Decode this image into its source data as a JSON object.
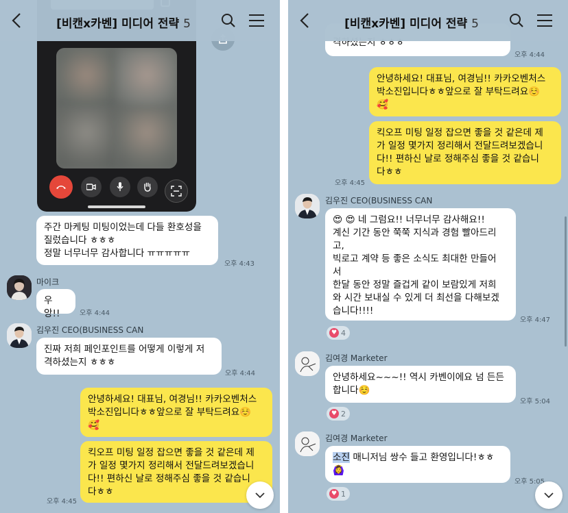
{
  "chat": {
    "title": "[비캔x카벤] 미디어 전략",
    "member_count": "5"
  },
  "colors": {
    "background": "#abc1d1",
    "incoming": "#ffffff",
    "outgoing": "#fbe64d",
    "heart": "#e94b6a"
  },
  "left": {
    "msg1": {
      "text": "주간 마케팅 미팅이었는데 다들 환호성을\n질렀습니다 ㅎㅎㅎ\n정말 너무너무 감사합니다 ㅠㅠㅠㅠㅠ",
      "time": "오후 4:43"
    },
    "mike": {
      "name": "마이크",
      "text": "우앙!!",
      "time": "오후 4:44"
    },
    "kim1": {
      "name": "김우진 CEO(BUSINESS CAN",
      "text": "진짜 저희 페인포인트를 어떻게 이렇게 저\n격하셨는지 ㅎㅎㅎ",
      "time": "오후 4:44"
    },
    "out1": {
      "text": "안녕하세요! 대표님, 여경님!! 카카오벤처스\n박소진입니다ㅎㅎ앞으로 잘 부탁드려요☺️\n🥰"
    },
    "out2": {
      "text": "킥오프 미팅 일정 잡으면 좋을 것 같은데 제\n가 일정 몇가지 정리해서 전달드려보겠습니\n다!! 편하신 날로 정해주심 좋을 것 같습니\n다ㅎㅎ",
      "time": "오후 4:45"
    }
  },
  "right": {
    "top_partial": {
      "text": "격하셨는지 ㅎㅎㅎ",
      "time": "오후 4:44"
    },
    "out1": {
      "text": "안녕하세요! 대표님, 여경님!! 카카오벤처스\n박소진입니다ㅎㅎ앞으로 잘 부탁드려요☺️\n🥰"
    },
    "out2": {
      "text": "킥오프 미팅 일정 잡으면 좋을 것 같은데 제\n가 일정 몇가지 정리해서 전달드려보겠습니\n다!! 편하신 날로 정해주심 좋을 것 같습니\n다ㅎㅎ",
      "time": "오후 4:45"
    },
    "kim": {
      "name": "김우진 CEO(BUSINESS CAN",
      "text": "😍 😍 네 그럼요!! 너무너무 감사해요!!\n계신 기간 동안 쭉쭉 지식과 경험 빨아드리\n고,\n빅로고 계약 등 좋은 소식도 최대한 만들어\n서\n한달 동안 정말 즐겁게 같이 보람있게 저희\n와 시간 보내실 수 있게 더 최선을 다해보겠\n습니다!!!!",
      "time": "오후 4:47",
      "reaction_count": "4"
    },
    "yk1": {
      "name": "김여경 Marketer",
      "text": "안녕하세요~~~!! 역시 카벤이에요 넘 든든\n합니다☺️",
      "time": "오후 5:04",
      "reaction_count": "2"
    },
    "yk2": {
      "name": "김여경 Marketer",
      "highlight": "소진",
      "text": " 매니저님 쌍수 들고 환영입니다!ㅎㅎ\n🙆‍♀️",
      "time": "오후 5:05",
      "reaction_count": "1"
    }
  }
}
